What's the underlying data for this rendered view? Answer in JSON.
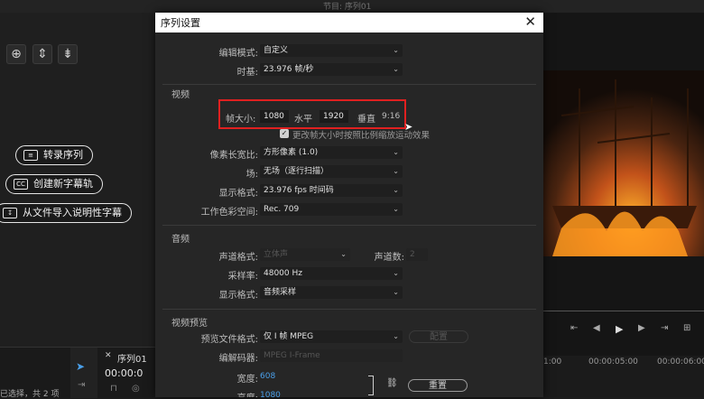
{
  "background_app": {
    "top_title": "节目: 序列01",
    "tool_icons": [
      "add-marker-icon",
      "go-to-in-icon",
      "go-to-out-icon"
    ],
    "buttons": [
      {
        "label": "转录序列",
        "icon": "transcribe-icon"
      },
      {
        "label": "创建新字幕轨",
        "icon": "cc-icon",
        "icon_text": "CC"
      },
      {
        "label": "从文件导入说明性字幕",
        "icon": "import-file-icon"
      }
    ],
    "status_text": "已选择，共 2 项",
    "sequence_tab": "序列01",
    "sequence_timecode": "00:00:0",
    "timeline_times": [
      "1:00",
      "00:00:05:00",
      "00:00:06:00"
    ]
  },
  "dialog": {
    "title": "序列设置",
    "close": "✕",
    "edit_mode": {
      "label": "编辑模式:",
      "value": "自定义"
    },
    "timebase": {
      "label": "时基:",
      "value": "23.976  帧/秒"
    },
    "video_section": "视频",
    "frame_size": {
      "label": "帧大小:",
      "width": "1080",
      "h_label": "水平",
      "height": "1920",
      "v_label": "垂直",
      "ratio": "9:16"
    },
    "scale_checkbox": {
      "label": "更改帧大小时按照比例缩放运动效果",
      "checked": true
    },
    "pixel_aspect": {
      "label": "像素长宽比:",
      "value": "方形像素 (1.0)"
    },
    "fields": {
      "label": "场:",
      "value": "无场（逐行扫描）"
    },
    "display_format": {
      "label": "显示格式:",
      "value": "23.976 fps 时间码"
    },
    "color_space": {
      "label": "工作色彩空间:",
      "value": "Rec. 709"
    },
    "audio_section": "音频",
    "channel_format": {
      "label": "声道格式:",
      "value": "立体声"
    },
    "channel_count": {
      "label": "声道数:",
      "value": "2"
    },
    "sample_rate": {
      "label": "采样率:",
      "value": "48000 Hz"
    },
    "audio_display_format": {
      "label": "显示格式:",
      "value": "音频采样"
    },
    "preview_section": "视频预览",
    "preview_format": {
      "label": "预览文件格式:",
      "value": "仅 I 帧 MPEG"
    },
    "configure_button": "配置",
    "codec": {
      "label": "编解码器:",
      "value": "MPEG I-Frame"
    },
    "width": {
      "label": "宽度:",
      "value": "608"
    },
    "height": {
      "label": "高度:",
      "value": "1080"
    },
    "reset_button": "重置"
  },
  "colors": {
    "accent_link": "#4a9fe8",
    "highlight_box": "#e02020"
  }
}
